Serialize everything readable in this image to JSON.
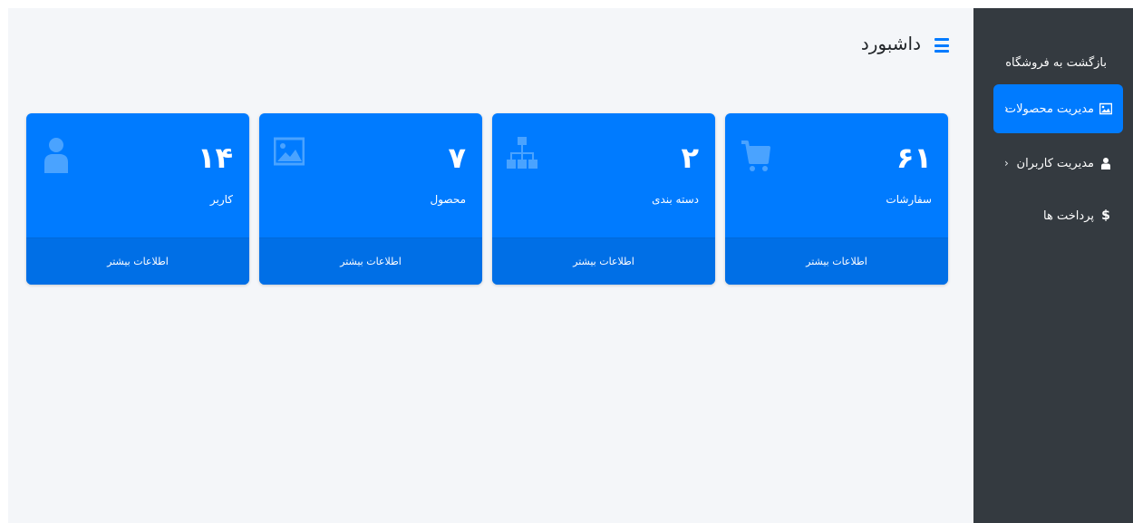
{
  "header": {
    "title": "داشبورد",
    "menu_icon": "hamburger-icon"
  },
  "sidebar": {
    "items": [
      {
        "label": "بازگشت به فروشگاه",
        "icon": "",
        "active": false
      },
      {
        "label": "مدیریت محصولات",
        "icon": "image-icon",
        "active": true,
        "chevron": "‹"
      },
      {
        "label": "مدیریت کاربران",
        "icon": "user-icon",
        "active": false,
        "chevron": "‹"
      },
      {
        "label": "پرداخت ها",
        "icon": "dollar-icon",
        "active": false
      }
    ]
  },
  "cards": [
    {
      "value": "۶۱",
      "caption": "سفارشات",
      "icon": "cart-icon",
      "footer": "اطلاعات بیشتر"
    },
    {
      "value": "۲",
      "caption": "دسته بندی",
      "icon": "sitemap-icon",
      "footer": "اطلاعات بیشتر"
    },
    {
      "value": "۷",
      "caption": "محصول",
      "icon": "image-icon",
      "footer": "اطلاعات بیشتر"
    },
    {
      "value": "۱۴",
      "caption": "کاربر",
      "icon": "user-icon",
      "footer": "اطلاعات بیشتر"
    }
  ],
  "colors": {
    "accent": "#007bff",
    "card_footer": "#006fe6",
    "sidebar_bg": "#343a40",
    "content_bg": "#f4f6f9",
    "icon_faded": "#4aa3ff"
  }
}
